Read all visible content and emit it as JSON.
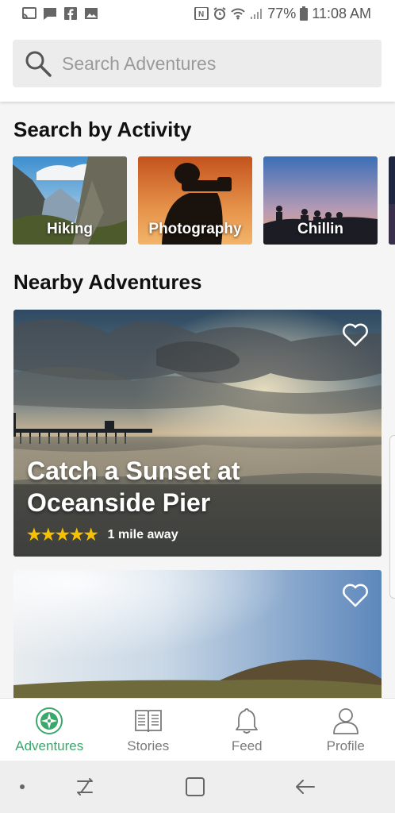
{
  "status_bar": {
    "battery": "77%",
    "time": "11:08 AM",
    "left_icons": [
      "cast-icon",
      "message-icon",
      "facebook-icon",
      "gallery-icon"
    ],
    "right_icons": [
      "nfc-icon",
      "alarm-icon",
      "wifi-icon",
      "signal-icon",
      "battery-icon"
    ]
  },
  "search": {
    "placeholder": "Search Adventures",
    "value": ""
  },
  "activity_section": {
    "title": "Search by Activity",
    "items": [
      {
        "label": "Hiking"
      },
      {
        "label": "Photography"
      },
      {
        "label": "Chillin"
      }
    ]
  },
  "nearby_section": {
    "title": "Nearby Adventures",
    "cards": [
      {
        "title": "Catch a Sunset at Oceanside Pier",
        "rating": 5,
        "stars": "★★★★★",
        "distance": "1 mile away"
      },
      {
        "title": "",
        "distance": ""
      }
    ]
  },
  "bottom_nav": {
    "items": [
      {
        "label": "Adventures",
        "icon": "compass-icon",
        "active": true
      },
      {
        "label": "Stories",
        "icon": "book-icon",
        "active": false
      },
      {
        "label": "Feed",
        "icon": "bell-icon",
        "active": false
      },
      {
        "label": "Profile",
        "icon": "person-icon",
        "active": false
      }
    ]
  },
  "colors": {
    "accent": "#3aa86b",
    "star": "#f6c100",
    "inactive": "#7a7a7a"
  }
}
